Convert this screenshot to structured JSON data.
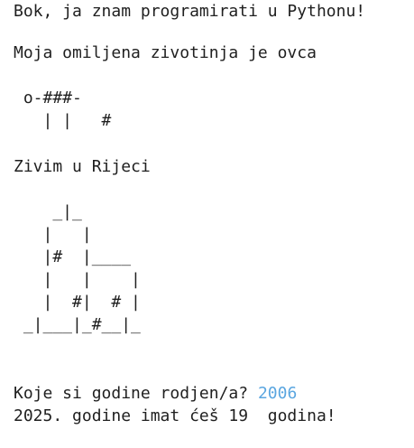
{
  "terminal": {
    "greeting": "Bok, ja znam programirati u Pythonu!",
    "favorite_animal": "Moja omiljena zivotinja je ovca",
    "sheep_art": [
      " o-###-",
      "   | |   #"
    ],
    "city": "Zivim u Rijeci",
    "building_art": [
      "    _|_",
      "   |   |",
      "   |#  |____",
      "   |   |    |",
      "   |  #|  # |",
      " _|___|_#__|_"
    ],
    "birth_year_prompt": "Koje si godine rodjen/a? ",
    "birth_year_input": "2006",
    "age_result": "2025. godine imat ćeš 19  godina!",
    "colors": {
      "background": "#ffffff",
      "text": "#1f1f1f",
      "user_input": "#5aa6e0"
    }
  }
}
